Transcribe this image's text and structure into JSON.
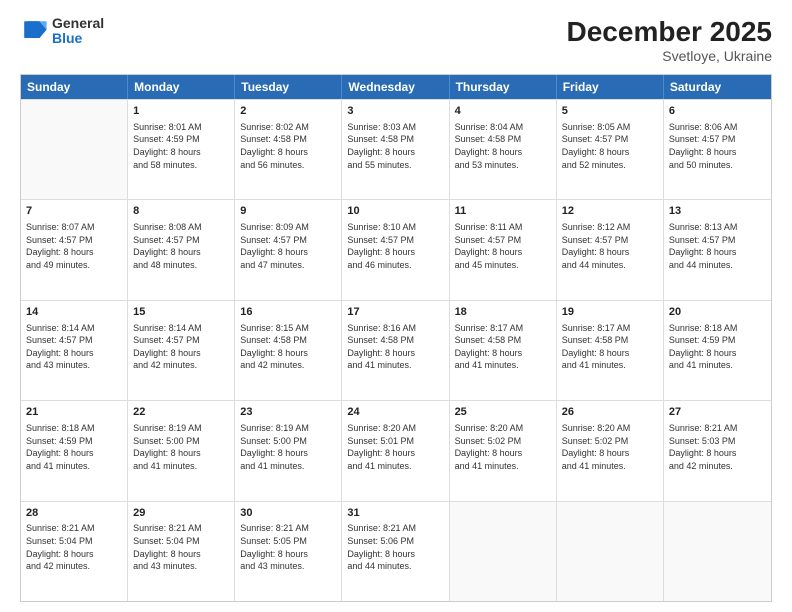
{
  "logo": {
    "general": "General",
    "blue": "Blue"
  },
  "title": "December 2025",
  "subtitle": "Svetloye, Ukraine",
  "days": [
    "Sunday",
    "Monday",
    "Tuesday",
    "Wednesday",
    "Thursday",
    "Friday",
    "Saturday"
  ],
  "weeks": [
    [
      {
        "date": "",
        "info": ""
      },
      {
        "date": "1",
        "info": "Sunrise: 8:01 AM\nSunset: 4:59 PM\nDaylight: 8 hours\nand 58 minutes."
      },
      {
        "date": "2",
        "info": "Sunrise: 8:02 AM\nSunset: 4:58 PM\nDaylight: 8 hours\nand 56 minutes."
      },
      {
        "date": "3",
        "info": "Sunrise: 8:03 AM\nSunset: 4:58 PM\nDaylight: 8 hours\nand 55 minutes."
      },
      {
        "date": "4",
        "info": "Sunrise: 8:04 AM\nSunset: 4:58 PM\nDaylight: 8 hours\nand 53 minutes."
      },
      {
        "date": "5",
        "info": "Sunrise: 8:05 AM\nSunset: 4:57 PM\nDaylight: 8 hours\nand 52 minutes."
      },
      {
        "date": "6",
        "info": "Sunrise: 8:06 AM\nSunset: 4:57 PM\nDaylight: 8 hours\nand 50 minutes."
      }
    ],
    [
      {
        "date": "7",
        "info": "Sunrise: 8:07 AM\nSunset: 4:57 PM\nDaylight: 8 hours\nand 49 minutes."
      },
      {
        "date": "8",
        "info": "Sunrise: 8:08 AM\nSunset: 4:57 PM\nDaylight: 8 hours\nand 48 minutes."
      },
      {
        "date": "9",
        "info": "Sunrise: 8:09 AM\nSunset: 4:57 PM\nDaylight: 8 hours\nand 47 minutes."
      },
      {
        "date": "10",
        "info": "Sunrise: 8:10 AM\nSunset: 4:57 PM\nDaylight: 8 hours\nand 46 minutes."
      },
      {
        "date": "11",
        "info": "Sunrise: 8:11 AM\nSunset: 4:57 PM\nDaylight: 8 hours\nand 45 minutes."
      },
      {
        "date": "12",
        "info": "Sunrise: 8:12 AM\nSunset: 4:57 PM\nDaylight: 8 hours\nand 44 minutes."
      },
      {
        "date": "13",
        "info": "Sunrise: 8:13 AM\nSunset: 4:57 PM\nDaylight: 8 hours\nand 44 minutes."
      }
    ],
    [
      {
        "date": "14",
        "info": "Sunrise: 8:14 AM\nSunset: 4:57 PM\nDaylight: 8 hours\nand 43 minutes."
      },
      {
        "date": "15",
        "info": "Sunrise: 8:14 AM\nSunset: 4:57 PM\nDaylight: 8 hours\nand 42 minutes."
      },
      {
        "date": "16",
        "info": "Sunrise: 8:15 AM\nSunset: 4:58 PM\nDaylight: 8 hours\nand 42 minutes."
      },
      {
        "date": "17",
        "info": "Sunrise: 8:16 AM\nSunset: 4:58 PM\nDaylight: 8 hours\nand 41 minutes."
      },
      {
        "date": "18",
        "info": "Sunrise: 8:17 AM\nSunset: 4:58 PM\nDaylight: 8 hours\nand 41 minutes."
      },
      {
        "date": "19",
        "info": "Sunrise: 8:17 AM\nSunset: 4:58 PM\nDaylight: 8 hours\nand 41 minutes."
      },
      {
        "date": "20",
        "info": "Sunrise: 8:18 AM\nSunset: 4:59 PM\nDaylight: 8 hours\nand 41 minutes."
      }
    ],
    [
      {
        "date": "21",
        "info": "Sunrise: 8:18 AM\nSunset: 4:59 PM\nDaylight: 8 hours\nand 41 minutes."
      },
      {
        "date": "22",
        "info": "Sunrise: 8:19 AM\nSunset: 5:00 PM\nDaylight: 8 hours\nand 41 minutes."
      },
      {
        "date": "23",
        "info": "Sunrise: 8:19 AM\nSunset: 5:00 PM\nDaylight: 8 hours\nand 41 minutes."
      },
      {
        "date": "24",
        "info": "Sunrise: 8:20 AM\nSunset: 5:01 PM\nDaylight: 8 hours\nand 41 minutes."
      },
      {
        "date": "25",
        "info": "Sunrise: 8:20 AM\nSunset: 5:02 PM\nDaylight: 8 hours\nand 41 minutes."
      },
      {
        "date": "26",
        "info": "Sunrise: 8:20 AM\nSunset: 5:02 PM\nDaylight: 8 hours\nand 41 minutes."
      },
      {
        "date": "27",
        "info": "Sunrise: 8:21 AM\nSunset: 5:03 PM\nDaylight: 8 hours\nand 42 minutes."
      }
    ],
    [
      {
        "date": "28",
        "info": "Sunrise: 8:21 AM\nSunset: 5:04 PM\nDaylight: 8 hours\nand 42 minutes."
      },
      {
        "date": "29",
        "info": "Sunrise: 8:21 AM\nSunset: 5:04 PM\nDaylight: 8 hours\nand 43 minutes."
      },
      {
        "date": "30",
        "info": "Sunrise: 8:21 AM\nSunset: 5:05 PM\nDaylight: 8 hours\nand 43 minutes."
      },
      {
        "date": "31",
        "info": "Sunrise: 8:21 AM\nSunset: 5:06 PM\nDaylight: 8 hours\nand 44 minutes."
      },
      {
        "date": "",
        "info": ""
      },
      {
        "date": "",
        "info": ""
      },
      {
        "date": "",
        "info": ""
      }
    ]
  ]
}
